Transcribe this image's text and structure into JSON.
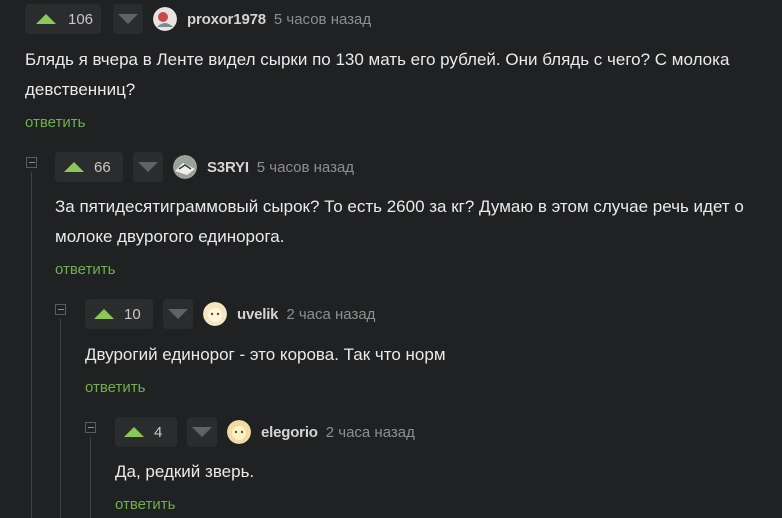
{
  "comments": [
    {
      "rating": "106",
      "author": "proxor1978",
      "time": "5 часов назад",
      "text_lines": [
        "Блядь я вчера в Ленте видел сырки по 130 мать его рублей. Они блядь с чего? С молока",
        "девственниц?"
      ],
      "reply_label": "ответить"
    },
    {
      "rating": "66",
      "author": "S3RYI",
      "time": "5 часов назад",
      "text_lines": [
        "За пятидесятиграммовый сырок? То есть 2600 за кг? Думаю в этом случае речь идет о",
        "молоке двурогого единорога."
      ],
      "reply_label": "ответить"
    },
    {
      "rating": "10",
      "author": "uvelik",
      "time": "2 часа назад",
      "text_lines": [
        "Двурогий единорог - это корова. Так что норм"
      ],
      "reply_label": "ответить"
    },
    {
      "rating": "4",
      "author": "elegorio",
      "time": "2 часа назад",
      "text_lines": [
        "Да, редкий зверь."
      ],
      "reply_label": "ответить"
    }
  ],
  "colors": {
    "background": "#202122",
    "upvote": "#8ac858",
    "reply": "#6fb04a",
    "text": "#eaeaea",
    "muted": "#8d8e8f"
  },
  "icons": [
    "upvote-icon",
    "downvote-icon",
    "collapse-icon",
    "avatar"
  ]
}
